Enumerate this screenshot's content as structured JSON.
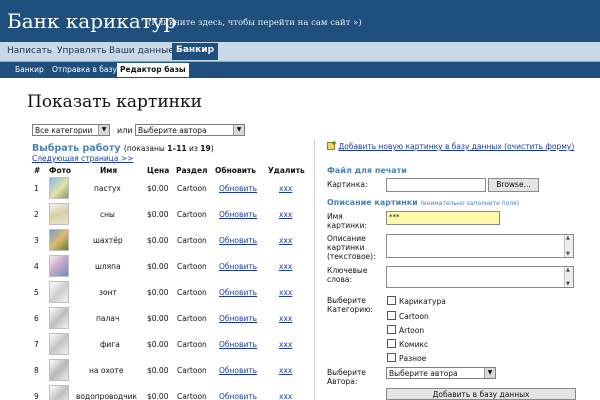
{
  "header": {
    "title": "Банк карикатур",
    "subtitle": "(Кликните здесь, чтобы перейти на сам сайт »)"
  },
  "nav": {
    "items": [
      "Написать",
      "Управлять",
      "Ваши данные",
      "Банкир"
    ],
    "active": "Банкир"
  },
  "subnav": {
    "items": [
      "Банкир",
      "Отправка в базу",
      "Редактор базы"
    ],
    "active": "Редактор базы"
  },
  "page_title": "Показать картинки",
  "filters": {
    "category": "Все категории",
    "or_label": "или",
    "author": "Выберите автора"
  },
  "list": {
    "heading": "Выбрать работу",
    "shown_prefix": "(показаны ",
    "shown_range": "1–11",
    "shown_of": " из ",
    "shown_total": "19",
    "shown_suffix": ")",
    "next_page": "Следующая страница >>",
    "columns": [
      "#",
      "Фото",
      "Имя",
      "Цена",
      "Раздел",
      "Обновить",
      "Удалить"
    ],
    "rows": [
      {
        "num": "1",
        "name": "пастух",
        "price": "$0.00",
        "section": "Cartoon",
        "update": "Обновить",
        "delete": "xxx"
      },
      {
        "num": "2",
        "name": "сны",
        "price": "$0.00",
        "section": "Cartoon",
        "update": "Обновить",
        "delete": "xxx"
      },
      {
        "num": "3",
        "name": "шахтёр",
        "price": "$0.00",
        "section": "Cartoon",
        "update": "Обновить",
        "delete": "xxx"
      },
      {
        "num": "4",
        "name": "шляпа",
        "price": "$0.00",
        "section": "Cartoon",
        "update": "Обновить",
        "delete": "xxx"
      },
      {
        "num": "5",
        "name": "зонт",
        "price": "$0.00",
        "section": "Cartoon",
        "update": "Обновить",
        "delete": "xxx"
      },
      {
        "num": "6",
        "name": "палач",
        "price": "$0.00",
        "section": "Cartoon",
        "update": "Обновить",
        "delete": "xxx"
      },
      {
        "num": "7",
        "name": "фига",
        "price": "$0.00",
        "section": "Cartoon",
        "update": "Обновить",
        "delete": "xxx"
      },
      {
        "num": "8",
        "name": "на охоте",
        "price": "$0.00",
        "section": "Cartoon",
        "update": "Обновить",
        "delete": "xxx"
      },
      {
        "num": "9",
        "name": "водопроводчик",
        "price": "$0.00",
        "section": "Cartoon",
        "update": "Обновить",
        "delete": "xxx"
      }
    ]
  },
  "form": {
    "add_link": "Добавить новую картинку в базу данных (очистить форму)",
    "file_heading": "Файл для печати",
    "picture_label": "Картинка:",
    "browse": "Browse...",
    "desc_heading": "Описание картинки",
    "desc_note": "(внимательно заполните поля)",
    "name_label": "Имя картинки:",
    "name_value": "***",
    "text_desc_label": "Описание картинки (текстовое):",
    "keywords_label": "Ключевые слова:",
    "category_label": "Выберите Категорию:",
    "categories": [
      "Карикатура",
      "Cartoon",
      "Artoon",
      "Комикс",
      "Разное"
    ],
    "author_label": "Выберите Автора:",
    "author_value": "Выберите автора",
    "submit": "Добавить в базу данных"
  },
  "colors": {
    "header_bg": "#1f4f7d",
    "nav_bg": "#c9d8e6",
    "heading_blue": "#4a82b4",
    "link_blue": "#1a3aa8",
    "name_field_bg": "#fff8a8"
  }
}
